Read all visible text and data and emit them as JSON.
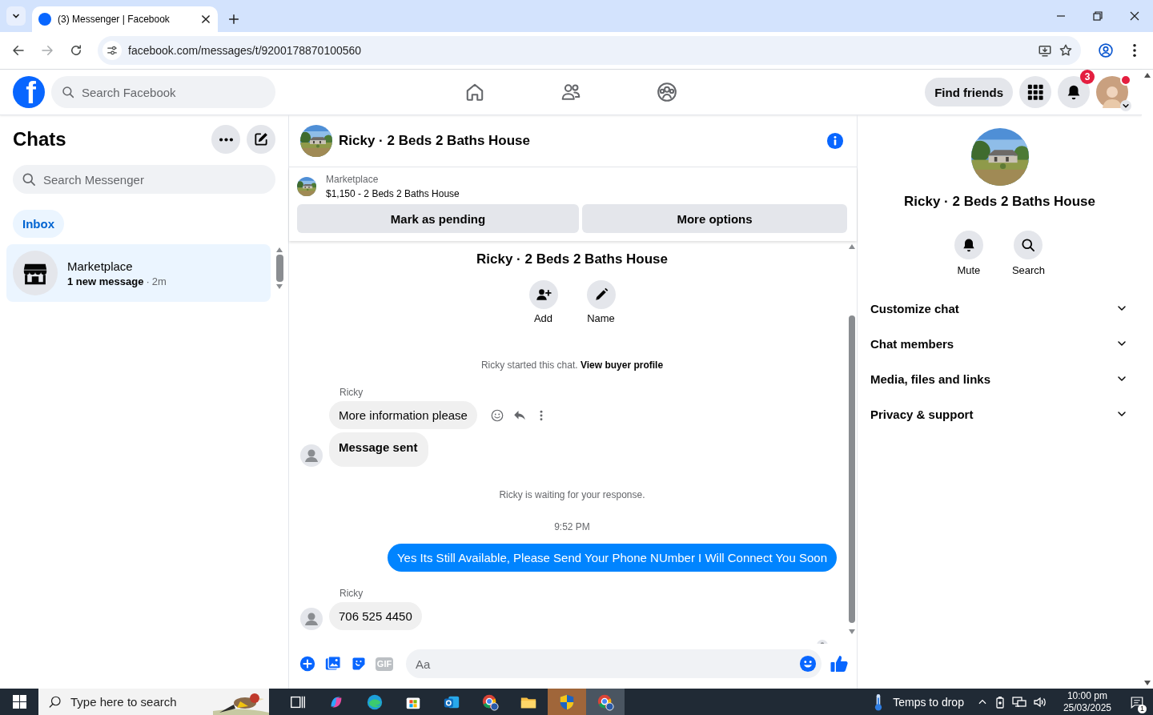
{
  "browser": {
    "tab_title": "(3) Messenger | Facebook",
    "url": "facebook.com/messages/t/9200178870100560"
  },
  "header": {
    "logo_letter": "f",
    "search_placeholder": "Search Facebook",
    "find_friends": "Find friends",
    "notification_count": "3"
  },
  "sidebar": {
    "title": "Chats",
    "search_placeholder": "Search Messenger",
    "filters": [
      {
        "label": "Inbox",
        "selected": true
      }
    ],
    "chats": [
      {
        "name": "Marketplace",
        "preview": "1 new message",
        "separator": "·",
        "time": "2m",
        "unread": true,
        "selected": true
      }
    ]
  },
  "conversation": {
    "title": "Ricky · 2 Beds 2 Baths House",
    "listing": {
      "source": "Marketplace",
      "summary": "$1,150 - 2 Beds 2 Baths House"
    },
    "actions": [
      "Mark as pending",
      "More options"
    ],
    "profile_name": "Ricky · 2 Beds 2 Baths House",
    "profile_actions": [
      {
        "kind": "add",
        "label": "Add"
      },
      {
        "kind": "name",
        "label": "Name"
      }
    ],
    "messages": [
      {
        "kind": "notice",
        "text": "Ricky started this chat.",
        "link": "View buyer profile"
      },
      {
        "kind": "sender",
        "text": "Ricky"
      },
      {
        "kind": "incoming",
        "text": "More information please",
        "avatar": false,
        "show_actions": true,
        "emphasis": false
      },
      {
        "kind": "incoming",
        "text": "Message sent",
        "avatar": true,
        "show_actions": false,
        "emphasis": true
      },
      {
        "kind": "notice",
        "text": "Ricky is waiting for your response."
      },
      {
        "kind": "time",
        "text": "9:52 PM"
      },
      {
        "kind": "outgoing",
        "text": "Yes Its Still Available, Please Send Your Phone NUmber I Will Connect You Soon"
      },
      {
        "kind": "sender",
        "text": "Ricky"
      },
      {
        "kind": "incoming",
        "text": "706 525 4450",
        "avatar": true,
        "show_actions": false,
        "emphasis": false
      }
    ],
    "composer": {
      "gif_label": "GIF",
      "placeholder": "Aa"
    }
  },
  "details": {
    "name": "Ricky · 2 Beds 2 Baths House",
    "actions": [
      {
        "kind": "mute",
        "label": "Mute"
      },
      {
        "kind": "search",
        "label": "Search"
      }
    ],
    "sections": [
      {
        "label": "Customize chat",
        "expanded": false
      },
      {
        "label": "Chat members",
        "expanded": false
      },
      {
        "label": "Media, files and links",
        "expanded": false
      },
      {
        "label": "Privacy & support",
        "expanded": false
      }
    ]
  },
  "taskbar": {
    "search_placeholder": "Type here to search",
    "weather": "Temps to drop",
    "time": "10:00 pm",
    "date": "25/03/2025",
    "notification_count": "1"
  }
}
